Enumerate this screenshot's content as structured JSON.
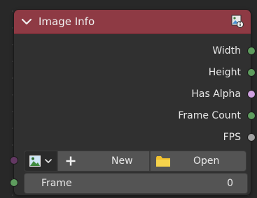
{
  "node": {
    "title": "Image Info",
    "header_color": "#8e3a44",
    "header_icon": "image-info-icon",
    "collapse_icon": "chevron-down-icon"
  },
  "outputs": [
    {
      "label": "Width",
      "socket_color": "#5e9c5e"
    },
    {
      "label": "Height",
      "socket_color": "#5e9c5e"
    },
    {
      "label": "Has Alpha",
      "socket_color": "#cfa1e0"
    },
    {
      "label": "Frame Count",
      "socket_color": "#5e9c5e"
    },
    {
      "label": "FPS",
      "socket_color": "#a1a1a1"
    }
  ],
  "inputs": {
    "image_socket_color": "#633863",
    "frame_socket_color": "#5e9c5e"
  },
  "image_selector": {
    "picker_icon": "image-browse-icon",
    "new_label": "New",
    "new_icon": "plus-icon",
    "open_label": "Open",
    "open_icon": "folder-icon"
  },
  "frame_field": {
    "label": "Frame",
    "value": "0"
  }
}
